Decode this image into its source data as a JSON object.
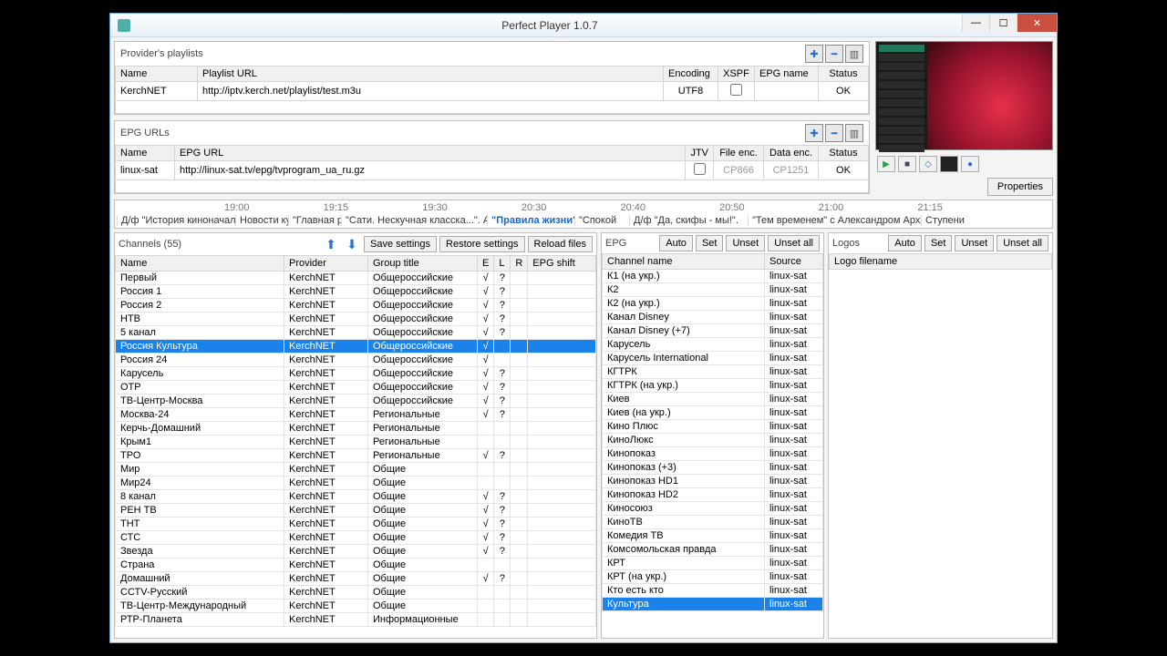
{
  "window": {
    "title": "Perfect Player 1.0.7"
  },
  "playlists": {
    "label": "Provider's playlists",
    "cols": {
      "name": "Name",
      "url": "Playlist URL",
      "enc": "Encoding",
      "xspf": "XSPF",
      "epg": "EPG name",
      "status": "Status"
    },
    "rows": [
      {
        "name": "KerchNET",
        "url": "http://iptv.kerch.net/playlist/test.m3u",
        "enc": "UTF8",
        "xspf": "",
        "epg": "",
        "status": "OK"
      }
    ]
  },
  "epgurls": {
    "label": "EPG URLs",
    "cols": {
      "name": "Name",
      "url": "EPG URL",
      "jtv": "JTV",
      "fenc": "File enc.",
      "denc": "Data enc.",
      "status": "Status"
    },
    "rows": [
      {
        "name": "linux-sat",
        "url": "http://linux-sat.tv/epg/tvprogram_ua_ru.gz",
        "jtv": "",
        "fenc": "CP866",
        "denc": "CP1251",
        "status": "OK"
      }
    ]
  },
  "properties": "Properties",
  "timeline": {
    "times": [
      "19:00",
      "19:15",
      "19:30",
      "20:30",
      "20:40",
      "20:50",
      "21:00",
      "21:15"
    ],
    "progs": [
      {
        "t": "Д/ф \"История киноначальник",
        "w": 130
      },
      {
        "t": "Новости кул",
        "w": 58
      },
      {
        "t": "\"Главная рол",
        "w": 58
      },
      {
        "t": "\"Сати. Нескучная класска...\". Але",
        "w": 160
      },
      {
        "t": "\"Правила жизни\".",
        "w": 96,
        "hl": true
      },
      {
        "t": "\"Спокой",
        "w": 60
      },
      {
        "t": "Д/ф \"Да, скифы - мы!\".",
        "w": 130
      },
      {
        "t": "\"Тем временем\" с Александром Арханге",
        "w": 190
      },
      {
        "t": "Ступени",
        "w": 50
      }
    ]
  },
  "channels": {
    "label": "Channels (55)",
    "buttons": {
      "save": "Save settings",
      "restore": "Restore settings",
      "reload": "Reload files"
    },
    "cols": {
      "name": "Name",
      "provider": "Provider",
      "group": "Group title",
      "e": "E",
      "l": "L",
      "r": "R",
      "shift": "EPG shift"
    },
    "rows": [
      {
        "n": "Первый",
        "p": "KerchNET",
        "g": "Общероссийские",
        "e": "√",
        "l": "?",
        "r": "",
        "s": ""
      },
      {
        "n": "Россия 1",
        "p": "KerchNET",
        "g": "Общероссийские",
        "e": "√",
        "l": "?",
        "r": "",
        "s": ""
      },
      {
        "n": "Россия 2",
        "p": "KerchNET",
        "g": "Общероссийские",
        "e": "√",
        "l": "?",
        "r": "",
        "s": ""
      },
      {
        "n": "НТВ",
        "p": "KerchNET",
        "g": "Общероссийские",
        "e": "√",
        "l": "?",
        "r": "",
        "s": ""
      },
      {
        "n": "5 канал",
        "p": "KerchNET",
        "g": "Общероссийские",
        "e": "√",
        "l": "?",
        "r": "",
        "s": ""
      },
      {
        "n": "Россия Культура",
        "p": "KerchNET",
        "g": "Общероссийские",
        "e": "√",
        "l": "",
        "r": "",
        "s": "",
        "sel": true
      },
      {
        "n": "Россия 24",
        "p": "KerchNET",
        "g": "Общероссийские",
        "e": "√",
        "l": "",
        "r": "",
        "s": ""
      },
      {
        "n": "Карусель",
        "p": "KerchNET",
        "g": "Общероссийские",
        "e": "√",
        "l": "?",
        "r": "",
        "s": ""
      },
      {
        "n": "ОТР",
        "p": "KerchNET",
        "g": "Общероссийские",
        "e": "√",
        "l": "?",
        "r": "",
        "s": ""
      },
      {
        "n": "ТВ-Центр-Москва",
        "p": "KerchNET",
        "g": "Общероссийские",
        "e": "√",
        "l": "?",
        "r": "",
        "s": ""
      },
      {
        "n": "Москва-24",
        "p": "KerchNET",
        "g": "Региональные",
        "e": "√",
        "l": "?",
        "r": "",
        "s": ""
      },
      {
        "n": "Керчь-Домашний",
        "p": "KerchNET",
        "g": "Региональные",
        "e": "",
        "l": "",
        "r": "",
        "s": ""
      },
      {
        "n": "Крым1",
        "p": "KerchNET",
        "g": "Региональные",
        "e": "",
        "l": "",
        "r": "",
        "s": ""
      },
      {
        "n": "ТРО",
        "p": "KerchNET",
        "g": "Региональные",
        "e": "√",
        "l": "?",
        "r": "",
        "s": ""
      },
      {
        "n": "Мир",
        "p": "KerchNET",
        "g": "Общие",
        "e": "",
        "l": "",
        "r": "",
        "s": ""
      },
      {
        "n": "Мир24",
        "p": "KerchNET",
        "g": "Общие",
        "e": "",
        "l": "",
        "r": "",
        "s": ""
      },
      {
        "n": "8 канал",
        "p": "KerchNET",
        "g": "Общие",
        "e": "√",
        "l": "?",
        "r": "",
        "s": ""
      },
      {
        "n": "РЕН ТВ",
        "p": "KerchNET",
        "g": "Общие",
        "e": "√",
        "l": "?",
        "r": "",
        "s": ""
      },
      {
        "n": "ТНТ",
        "p": "KerchNET",
        "g": "Общие",
        "e": "√",
        "l": "?",
        "r": "",
        "s": ""
      },
      {
        "n": "СТС",
        "p": "KerchNET",
        "g": "Общие",
        "e": "√",
        "l": "?",
        "r": "",
        "s": ""
      },
      {
        "n": "Звезда",
        "p": "KerchNET",
        "g": "Общие",
        "e": "√",
        "l": "?",
        "r": "",
        "s": ""
      },
      {
        "n": "Страна",
        "p": "KerchNET",
        "g": "Общие",
        "e": "",
        "l": "",
        "r": "",
        "s": ""
      },
      {
        "n": "Домашний",
        "p": "KerchNET",
        "g": "Общие",
        "e": "√",
        "l": "?",
        "r": "",
        "s": ""
      },
      {
        "n": "ССТV-Русский",
        "p": "KerchNET",
        "g": "Общие",
        "e": "",
        "l": "",
        "r": "",
        "s": ""
      },
      {
        "n": "ТВ-Центр-Международный",
        "p": "KerchNET",
        "g": "Общие",
        "e": "",
        "l": "",
        "r": "",
        "s": ""
      },
      {
        "n": "РТР-Планета",
        "p": "KerchNET",
        "g": "Информационные",
        "e": "",
        "l": "",
        "r": "",
        "s": ""
      }
    ]
  },
  "epg": {
    "label": "EPG",
    "buttons": {
      "auto": "Auto",
      "set": "Set",
      "unset": "Unset",
      "unsetall": "Unset all"
    },
    "cols": {
      "name": "Channel name",
      "source": "Source"
    },
    "rows": [
      {
        "n": "К1 (на укр.)",
        "s": "linux-sat"
      },
      {
        "n": "К2",
        "s": "linux-sat"
      },
      {
        "n": "К2 (на укр.)",
        "s": "linux-sat"
      },
      {
        "n": "Канал Disney",
        "s": "linux-sat"
      },
      {
        "n": "Канал Disney (+7)",
        "s": "linux-sat"
      },
      {
        "n": "Карусель",
        "s": "linux-sat"
      },
      {
        "n": "Карусель International",
        "s": "linux-sat"
      },
      {
        "n": "КГТРК",
        "s": "linux-sat"
      },
      {
        "n": "КГТРК (на укр.)",
        "s": "linux-sat"
      },
      {
        "n": "Киев",
        "s": "linux-sat"
      },
      {
        "n": "Киев (на укр.)",
        "s": "linux-sat"
      },
      {
        "n": "Кино Плюс",
        "s": "linux-sat"
      },
      {
        "n": "КиноЛюкс",
        "s": "linux-sat"
      },
      {
        "n": "Кинопоказ",
        "s": "linux-sat"
      },
      {
        "n": "Кинопоказ (+3)",
        "s": "linux-sat"
      },
      {
        "n": "Кинопоказ HD1",
        "s": "linux-sat"
      },
      {
        "n": "Кинопоказ HD2",
        "s": "linux-sat"
      },
      {
        "n": "Киносоюз",
        "s": "linux-sat"
      },
      {
        "n": "КиноТВ",
        "s": "linux-sat"
      },
      {
        "n": "Комедия ТВ",
        "s": "linux-sat"
      },
      {
        "n": "Комсомольская правда",
        "s": "linux-sat"
      },
      {
        "n": "КРТ",
        "s": "linux-sat"
      },
      {
        "n": "КРТ (на укр.)",
        "s": "linux-sat"
      },
      {
        "n": "Кто есть кто",
        "s": "linux-sat"
      },
      {
        "n": "Культура",
        "s": "linux-sat",
        "sel": true
      }
    ]
  },
  "logos": {
    "label": "Logos",
    "buttons": {
      "auto": "Auto",
      "set": "Set",
      "unset": "Unset",
      "unsetall": "Unset all"
    },
    "cols": {
      "name": "Logo filename"
    }
  }
}
